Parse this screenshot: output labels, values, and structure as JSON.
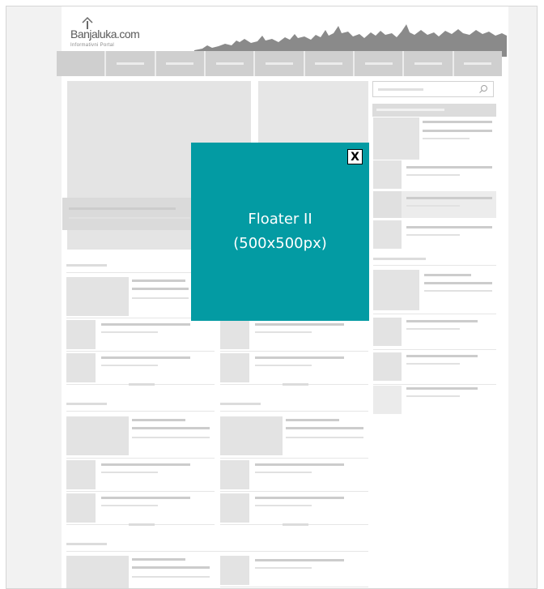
{
  "site": {
    "logo_text": "Banjaluka.com",
    "logo_tagline": "Informativni Portal"
  },
  "search": {
    "placeholder": ""
  },
  "popup": {
    "text": "Floater II\n(500x500px)",
    "close_label": "X"
  },
  "colors": {
    "popup_background": "#039ba3",
    "placeholder_grey": "#e3e3e3",
    "nav_grey": "#cfcfcf"
  },
  "icons": [
    "house-logo-icon",
    "skyline-banner-icon",
    "search-icon",
    "close-icon"
  ]
}
